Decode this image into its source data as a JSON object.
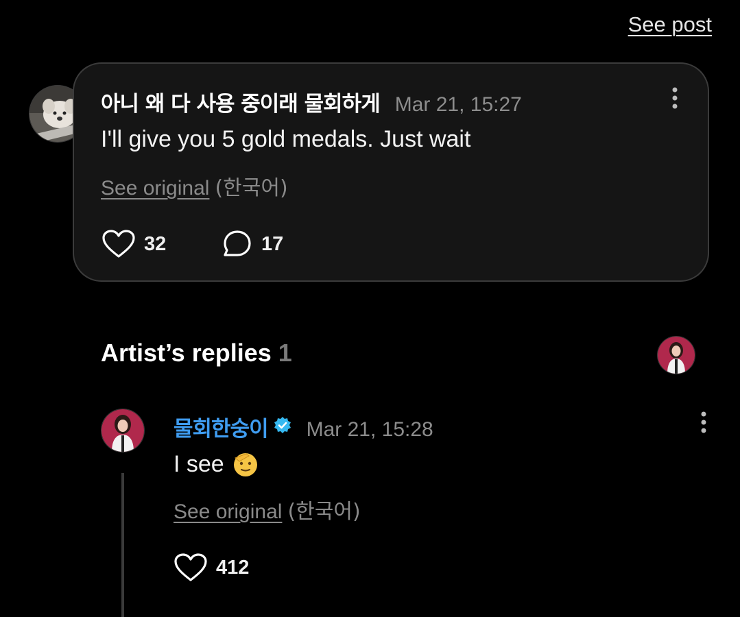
{
  "header": {
    "see_post": "See post"
  },
  "comment": {
    "author": "아니 왜 다 사용 중이래 물회하게",
    "timestamp": "Mar 21, 15:27",
    "text": "I'll give you 5 gold medals. Just wait",
    "see_original": "See original",
    "language": "(한국어)",
    "likes": "32",
    "replies": "17"
  },
  "artist_replies": {
    "title": "Artist’s replies",
    "count": "1"
  },
  "reply": {
    "author": "물회한숭이",
    "timestamp": "Mar 21, 15:28",
    "text": "I see",
    "emoji": "🫡",
    "see_original": "See original",
    "language": "(한국어)",
    "likes": "412"
  },
  "icons": {
    "more": "more-vertical-icon",
    "like": "heart-icon",
    "reply": "comment-bubble-icon",
    "verified": "verified-badge-icon"
  },
  "colors": {
    "background": "#000000",
    "card": "#151515",
    "artist_name": "#3f9cf0",
    "verified": "#35b8f0",
    "muted": "#8c8c8c"
  }
}
